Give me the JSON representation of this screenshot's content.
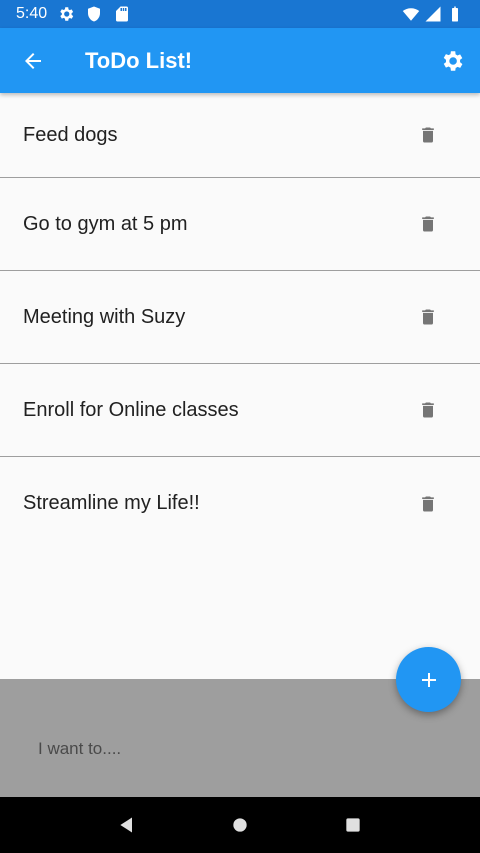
{
  "status_bar": {
    "time": "5:40",
    "icons": [
      "gear-icon",
      "shield-icon",
      "sd-card-icon",
      "wifi-icon",
      "signal-icon",
      "battery-icon"
    ]
  },
  "app_bar": {
    "title": "ToDo List!",
    "back_icon": "arrow-back-icon",
    "settings_icon": "gear-icon",
    "color": "#2196f3"
  },
  "todos": [
    {
      "text": "Feed dogs"
    },
    {
      "text": "Go to gym at 5 pm"
    },
    {
      "text": "Meeting with Suzy"
    },
    {
      "text": "Enroll for Online classes"
    },
    {
      "text": "Streamline my Life!!"
    }
  ],
  "input": {
    "placeholder": "I want to....",
    "value": ""
  },
  "fab": {
    "icon": "plus-icon"
  },
  "nav_bar": {
    "icons": [
      "back-triangle-icon",
      "home-circle-icon",
      "recents-square-icon"
    ]
  }
}
